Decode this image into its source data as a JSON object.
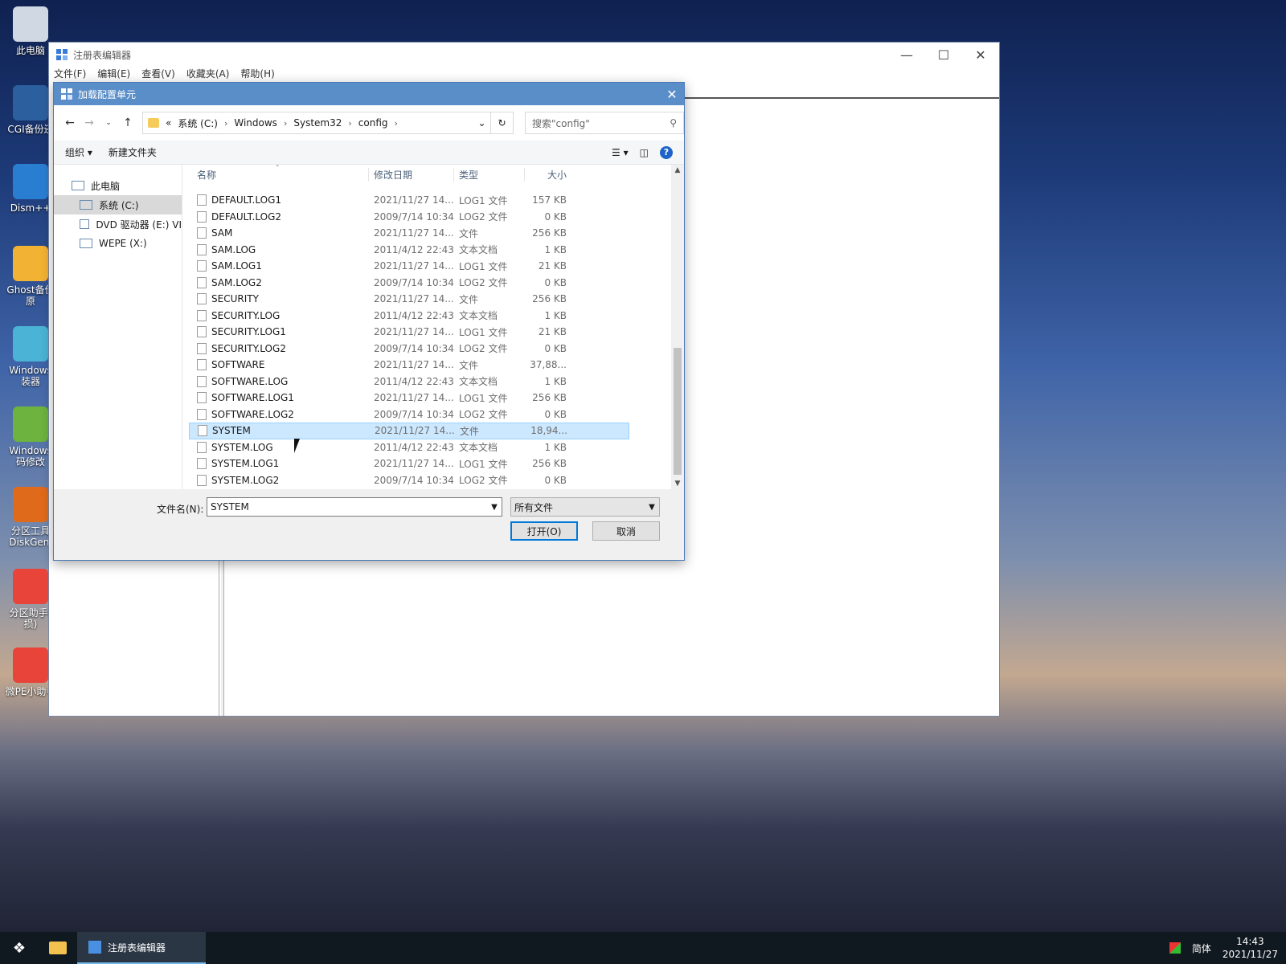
{
  "desktop": {
    "icons": [
      {
        "label": "此电脑"
      },
      {
        "label": "CGI备份还"
      },
      {
        "label": "Dism++"
      },
      {
        "label": "Ghost备份\n原"
      },
      {
        "label": "Windows\n装器"
      },
      {
        "label": "Windows\n码修改"
      },
      {
        "label": "分区工具\nDiskGeni"
      },
      {
        "label": "分区助手(\n损)"
      },
      {
        "label": "微PE小助手"
      }
    ]
  },
  "regedit": {
    "title": "注册表编辑器",
    "menu": [
      "文件(F)",
      "编辑(E)",
      "查看(V)",
      "收藏夹(A)",
      "帮助(H)"
    ]
  },
  "dialog": {
    "title": "加载配置单元",
    "close": "✕",
    "breadcrumb": {
      "lead": "«",
      "parts": [
        "系统 (C:)",
        "Windows",
        "System32",
        "config"
      ]
    },
    "search_placeholder": "搜索\"config\"",
    "toolbar": {
      "organize": "组织 ▾",
      "new_folder": "新建文件夹"
    },
    "nav": [
      {
        "label": "此电脑",
        "selected": false
      },
      {
        "label": "系统 (C:)",
        "selected": true
      },
      {
        "label": "DVD 驱动器 (E:) VI",
        "selected": false
      },
      {
        "label": "WEPE (X:)",
        "selected": false
      }
    ],
    "columns": {
      "name": "名称",
      "date": "修改日期",
      "type": "类型",
      "size": "大小"
    },
    "files": [
      {
        "name": "DEFAULT.LOG1",
        "date": "2021/11/27 14...",
        "type": "LOG1 文件",
        "size": "157 KB",
        "selected": false
      },
      {
        "name": "DEFAULT.LOG2",
        "date": "2009/7/14 10:34",
        "type": "LOG2 文件",
        "size": "0 KB",
        "selected": false
      },
      {
        "name": "SAM",
        "date": "2021/11/27 14...",
        "type": "文件",
        "size": "256 KB",
        "selected": false
      },
      {
        "name": "SAM.LOG",
        "date": "2011/4/12 22:43",
        "type": "文本文档",
        "size": "1 KB",
        "selected": false
      },
      {
        "name": "SAM.LOG1",
        "date": "2021/11/27 14...",
        "type": "LOG1 文件",
        "size": "21 KB",
        "selected": false
      },
      {
        "name": "SAM.LOG2",
        "date": "2009/7/14 10:34",
        "type": "LOG2 文件",
        "size": "0 KB",
        "selected": false
      },
      {
        "name": "SECURITY",
        "date": "2021/11/27 14...",
        "type": "文件",
        "size": "256 KB",
        "selected": false
      },
      {
        "name": "SECURITY.LOG",
        "date": "2011/4/12 22:43",
        "type": "文本文档",
        "size": "1 KB",
        "selected": false
      },
      {
        "name": "SECURITY.LOG1",
        "date": "2021/11/27 14...",
        "type": "LOG1 文件",
        "size": "21 KB",
        "selected": false
      },
      {
        "name": "SECURITY.LOG2",
        "date": "2009/7/14 10:34",
        "type": "LOG2 文件",
        "size": "0 KB",
        "selected": false
      },
      {
        "name": "SOFTWARE",
        "date": "2021/11/27 14...",
        "type": "文件",
        "size": "37,88...",
        "selected": false
      },
      {
        "name": "SOFTWARE.LOG",
        "date": "2011/4/12 22:43",
        "type": "文本文档",
        "size": "1 KB",
        "selected": false
      },
      {
        "name": "SOFTWARE.LOG1",
        "date": "2021/11/27 14...",
        "type": "LOG1 文件",
        "size": "256 KB",
        "selected": false
      },
      {
        "name": "SOFTWARE.LOG2",
        "date": "2009/7/14 10:34",
        "type": "LOG2 文件",
        "size": "0 KB",
        "selected": false
      },
      {
        "name": "SYSTEM",
        "date": "2021/11/27 14...",
        "type": "文件",
        "size": "18,94...",
        "selected": true
      },
      {
        "name": "SYSTEM.LOG",
        "date": "2011/4/12 22:43",
        "type": "文本文档",
        "size": "1 KB",
        "selected": false
      },
      {
        "name": "SYSTEM.LOG1",
        "date": "2021/11/27 14...",
        "type": "LOG1 文件",
        "size": "256 KB",
        "selected": false
      },
      {
        "name": "SYSTEM.LOG2",
        "date": "2009/7/14 10:34",
        "type": "LOG2 文件",
        "size": "0 KB",
        "selected": false
      }
    ],
    "filename_label": "文件名(N):",
    "filename_value": "SYSTEM",
    "filetype_value": "所有文件",
    "open_label": "打开(O)",
    "cancel_label": "取消"
  },
  "taskbar": {
    "app_label": "注册表编辑器",
    "ime": "简体",
    "time": "14:43",
    "date": "2021/11/27"
  },
  "colors": {
    "accent": "#0078d7",
    "selection": "#cce8ff",
    "dialog_title": "#5a8ec8"
  }
}
